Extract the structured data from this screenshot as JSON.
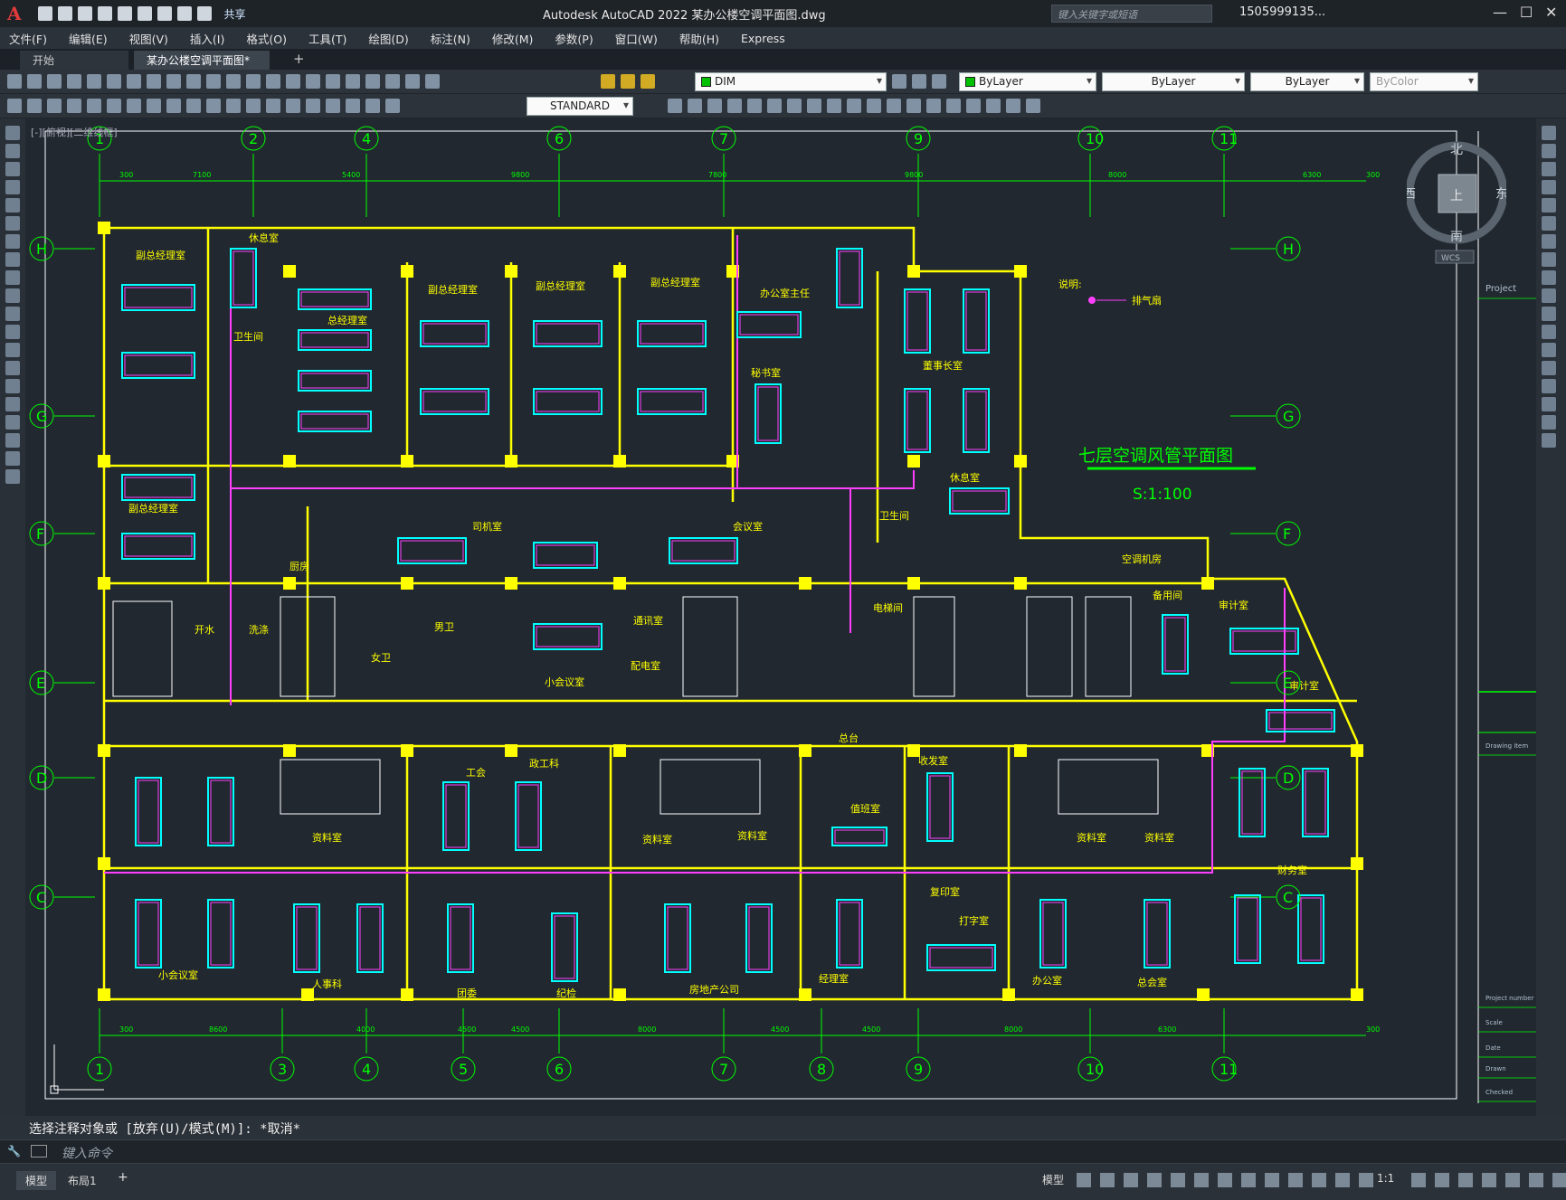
{
  "app": {
    "title": "Autodesk AutoCAD 2022    某办公楼空调平面图.dwg",
    "logo": "A",
    "share": "共享",
    "search_placeholder": "键入关键字或短语",
    "user": "1505999135..."
  },
  "menu": [
    "文件(F)",
    "编辑(E)",
    "视图(V)",
    "插入(I)",
    "格式(O)",
    "工具(T)",
    "绘图(D)",
    "标注(N)",
    "修改(M)",
    "参数(P)",
    "窗口(W)",
    "帮助(H)",
    "Express"
  ],
  "tabs": {
    "start": "开始",
    "file": "某办公楼空调平面图*",
    "add": "+"
  },
  "toolbar": {
    "layer": "DIM",
    "color": "ByLayer",
    "linetype": "ByLayer",
    "lineweight": "ByLayer",
    "plotstyle": "ByColor",
    "textstyle": "STANDARD"
  },
  "viewport": {
    "label": "[-][俯视][二维线框]",
    "viewcube": {
      "north": "北",
      "south": "南",
      "west": "西",
      "east": "东",
      "top": "上",
      "wcs": "WCS"
    }
  },
  "drawing": {
    "title": "七层空调风管平面图",
    "scale": "S:1:100",
    "legend_title": "说明:",
    "legend_item": "排气扇",
    "grid_columns_top": [
      "1",
      "2",
      "4",
      "6",
      "7",
      "9",
      "10",
      "11"
    ],
    "grid_columns_bottom": [
      "1",
      "3",
      "4",
      "5",
      "6",
      "7",
      "8",
      "9",
      "10",
      "11"
    ],
    "grid_rows": [
      "H",
      "G",
      "F",
      "E",
      "D",
      "C"
    ],
    "top_dims": [
      "300",
      "7100",
      "5400",
      "9800",
      "7800",
      "9800",
      "8000",
      "6300",
      "300"
    ],
    "bottom_dims": [
      "300",
      "8600",
      "4000",
      "4500",
      "4500",
      "8000",
      "4500",
      "4500",
      "8000",
      "6300",
      "300"
    ],
    "rooms": [
      "副总经理室",
      "休息室",
      "卫生间",
      "总经理室",
      "副总经理室",
      "副总经理室",
      "副总经理室",
      "办公室主任",
      "秘书室",
      "董事长室",
      "休息室",
      "卫生间",
      "副总经理室",
      "司机室",
      "会议室",
      "厨房",
      "男卫",
      "女卫",
      "洗涤",
      "开水",
      "小会议室",
      "通讯室",
      "配电室",
      "电梯间",
      "空调机房",
      "备用间",
      "审计室",
      "审计室",
      "总台",
      "资料室",
      "工会",
      "政工科",
      "资料室",
      "资料室",
      "收发室",
      "值班室",
      "资料室",
      "资料室",
      "财务室",
      "复印室",
      "打字室",
      "小会议室",
      "人事科",
      "团委",
      "纪检",
      "房地产公司",
      "经理室",
      "办公室",
      "总会室"
    ]
  },
  "title_block": [
    "Project",
    "Drawing item",
    "Project number",
    "Scale",
    "Date",
    "Drawn",
    "Checked"
  ],
  "command": {
    "history": "选择注释对象或 [放弃(U)/模式(M)]: *取消*",
    "placeholder": "键入命令"
  },
  "status": {
    "layouts": [
      "模型",
      "布局1"
    ],
    "add_layout": "+",
    "model": "模型",
    "annotation_scale": "1:1"
  }
}
